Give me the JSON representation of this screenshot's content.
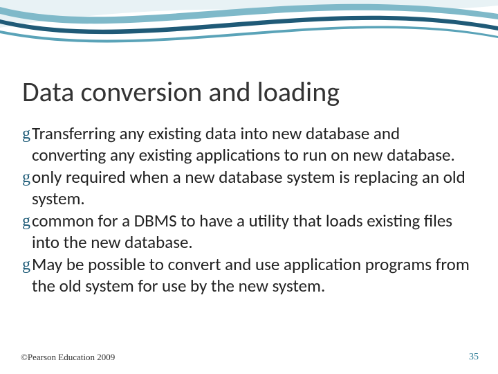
{
  "slide": {
    "title": "Data conversion and loading",
    "bullets": [
      "Transferring any existing data into new database and converting any existing applications to run on new database.",
      "only required when a new database system is replacing an old system.",
      "common for a DBMS to have a utility that loads existing files into the new database.",
      "May be possible to convert and use application programs from the old system for use by the new system."
    ],
    "footer_left": "©Pearson Education 2009",
    "page_number": "35",
    "bullet_glyph": "g"
  },
  "theme": {
    "accent": "#2a7a94",
    "wave_dark": "#1f5a77",
    "wave_light": "#7fb9c9"
  }
}
